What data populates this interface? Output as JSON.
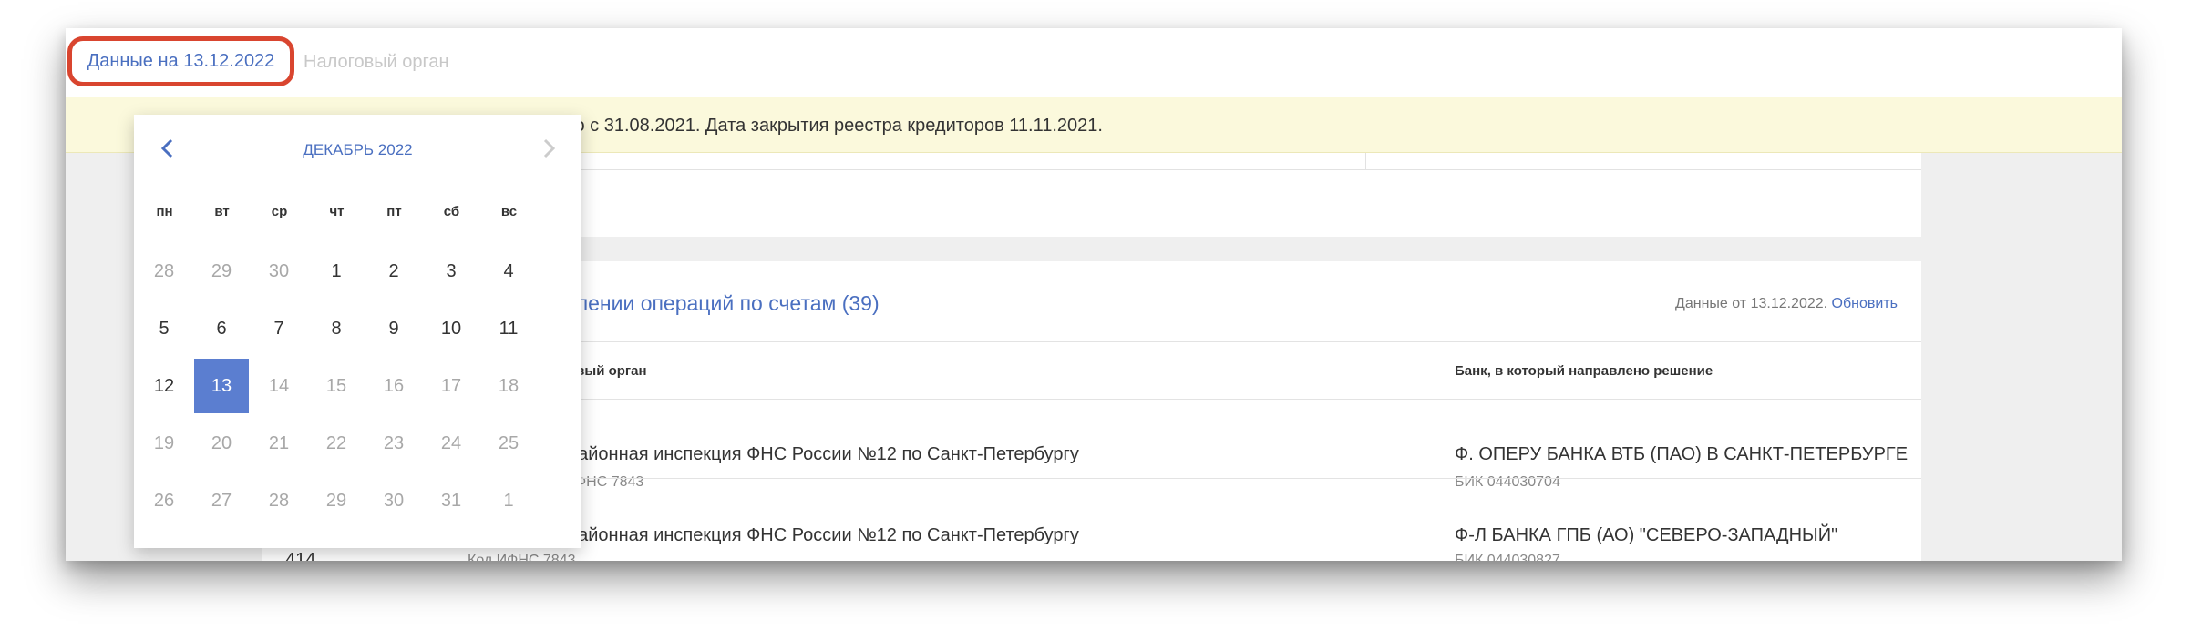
{
  "topbar": {
    "date_tab": "Данные на 13.12.2022",
    "tax_tab": "Налоговый орган"
  },
  "banner": {
    "text": "зводство с 31.08.2021. Дата закрытия реестра кредиторов 11.11.2021."
  },
  "section": {
    "title": "влении операций по счетам (39)",
    "data_from": "Данные от 13.12.2022.",
    "refresh": "Обновить"
  },
  "table": {
    "headers": {
      "tax_organ": "овый орган",
      "bank": "Банк, в который направлено решение"
    },
    "rows": [
      {
        "number": "",
        "tax_organ": "районная инспекция ФНС России №12 по Санкт-Петербургу",
        "tax_code": "ФНС 7843",
        "bank": "Ф. ОПЕРУ БАНКА ВТБ (ПАО) В САНКТ-ПЕТЕРБУРГЕ",
        "bik": "БИК 044030704"
      },
      {
        "number": "414",
        "tax_organ": "районная инспекция ФНС России №12 по Санкт-Петербургу",
        "tax_code": "Код ИФНС 7843",
        "bank": "Ф-Л БАНКА ГПБ (АО) \"СЕВЕРО-ЗАПАДНЫЙ\"",
        "bik": "БИК 044030827"
      }
    ]
  },
  "calendar": {
    "month_title": "ДЕКАБРЬ 2022",
    "prev_icon": "chevron-left-icon",
    "next_icon": "chevron-right-icon",
    "weekdays": [
      "пн",
      "вт",
      "ср",
      "чт",
      "пт",
      "сб",
      "вс"
    ],
    "weeks": [
      [
        {
          "d": "28",
          "m": true
        },
        {
          "d": "29",
          "m": true
        },
        {
          "d": "30",
          "m": true
        },
        {
          "d": "1"
        },
        {
          "d": "2"
        },
        {
          "d": "3"
        },
        {
          "d": "4"
        }
      ],
      [
        {
          "d": "5"
        },
        {
          "d": "6"
        },
        {
          "d": "7"
        },
        {
          "d": "8"
        },
        {
          "d": "9"
        },
        {
          "d": "10"
        },
        {
          "d": "11"
        }
      ],
      [
        {
          "d": "12"
        },
        {
          "d": "13",
          "sel": true
        },
        {
          "d": "14",
          "m": true
        },
        {
          "d": "15",
          "m": true
        },
        {
          "d": "16",
          "m": true
        },
        {
          "d": "17",
          "m": true
        },
        {
          "d": "18",
          "m": true
        }
      ],
      [
        {
          "d": "19",
          "m": true
        },
        {
          "d": "20",
          "m": true
        },
        {
          "d": "21",
          "m": true
        },
        {
          "d": "22",
          "m": true
        },
        {
          "d": "23",
          "m": true
        },
        {
          "d": "24",
          "m": true
        },
        {
          "d": "25",
          "m": true
        }
      ],
      [
        {
          "d": "26",
          "m": true
        },
        {
          "d": "27",
          "m": true
        },
        {
          "d": "28",
          "m": true
        },
        {
          "d": "29",
          "m": true
        },
        {
          "d": "30",
          "m": true
        },
        {
          "d": "31",
          "m": true
        },
        {
          "d": "1",
          "m": true
        }
      ]
    ]
  },
  "colors": {
    "accent": "#4a6fc0",
    "selected_day": "#5b7ed0",
    "highlight_border": "#d9452f",
    "banner_bg": "#fbf9dc"
  }
}
